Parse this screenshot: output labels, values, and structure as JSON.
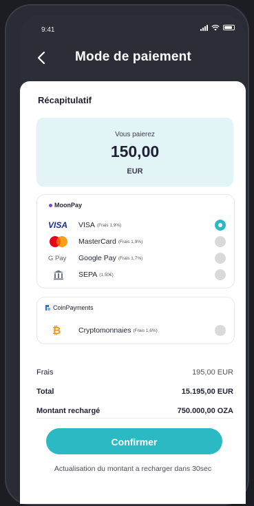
{
  "status_bar": {
    "time": "9:41"
  },
  "header": {
    "title": "Mode de paiement"
  },
  "summary_title": "Récapitulatif",
  "amount": {
    "label": "Vous paierez",
    "value": "150,00",
    "currency": "EUR"
  },
  "providers": [
    {
      "brand": "MoonPay",
      "methods": [
        {
          "logo": "visa-logo",
          "logo_text": "VISA",
          "name": "VISA",
          "fee": "(Frais 1,9%)",
          "selected": true
        },
        {
          "logo": "mastercard-logo",
          "name": "MasterCard",
          "fee": "(Frais 1,9%)",
          "selected": false
        },
        {
          "logo": "google-pay-logo",
          "logo_text": "G Pay",
          "name": "Google Pay",
          "fee": "(Frais 1,7%)",
          "selected": false
        },
        {
          "logo": "bank-icon",
          "name": "SEPA",
          "fee": "(1,50€)",
          "selected": false
        }
      ]
    },
    {
      "brand": "CoinPayments",
      "methods": [
        {
          "logo": "bitcoin-icon",
          "logo_text": "₿",
          "name": "Cryptomonnaies",
          "fee": "(Frais 1,6%)",
          "selected": false
        }
      ]
    }
  ],
  "totals": [
    {
      "label": "Frais",
      "value": "195,00 EUR",
      "bold": false
    },
    {
      "label": "Total",
      "value": "15.195,00 EUR",
      "bold": true
    },
    {
      "label": "Montant rechargé",
      "value": "750.000,00 OZA",
      "bold": true
    }
  ],
  "confirm_label": "Confirmer",
  "refresh_note": "Actualisation du montant a recharger dans 30sec",
  "colors": {
    "accent": "#2bbac4",
    "highlight_bg": "#e3f4f7",
    "dark_bg": "#2c2e37"
  }
}
